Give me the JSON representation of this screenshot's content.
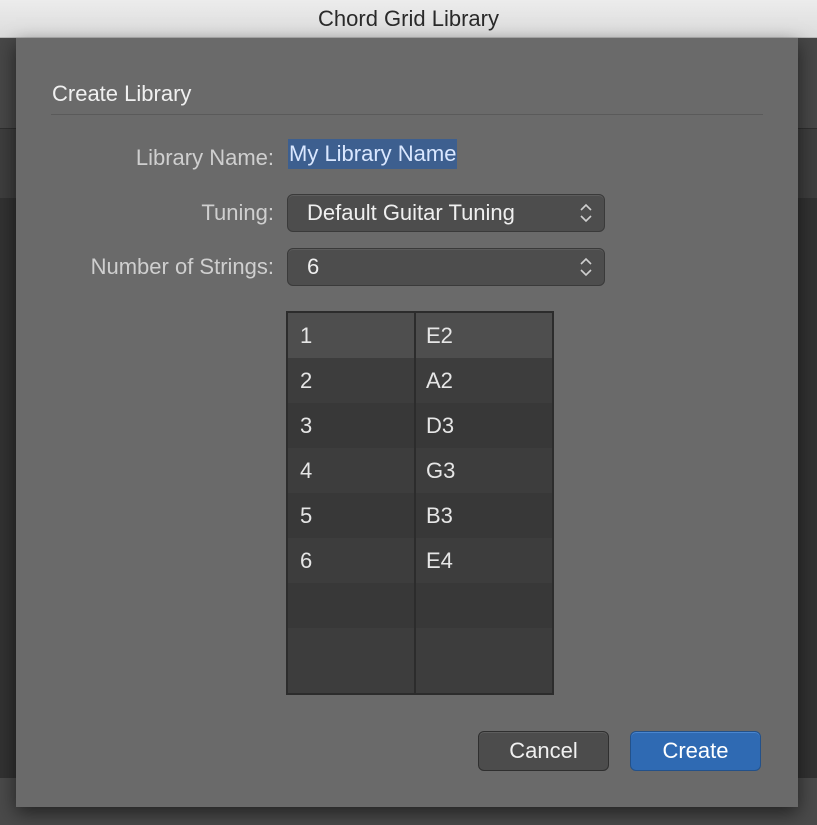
{
  "window": {
    "title": "Chord Grid Library"
  },
  "sheet": {
    "title": "Create Library",
    "library_name": {
      "label": "Library Name:",
      "value": "My Library Name"
    },
    "tuning": {
      "label": "Tuning:",
      "value": "Default Guitar Tuning"
    },
    "strings": {
      "label": "Number of Strings:",
      "value": "6"
    },
    "table": {
      "rows": [
        {
          "string": "1",
          "note": "E2"
        },
        {
          "string": "2",
          "note": "A2"
        },
        {
          "string": "3",
          "note": "D3"
        },
        {
          "string": "4",
          "note": "G3"
        },
        {
          "string": "5",
          "note": "B3"
        },
        {
          "string": "6",
          "note": "E4"
        }
      ]
    },
    "buttons": {
      "cancel": "Cancel",
      "create": "Create"
    }
  },
  "colors": {
    "accent": "#2f6ab3",
    "selection": "#3d5f8f"
  }
}
